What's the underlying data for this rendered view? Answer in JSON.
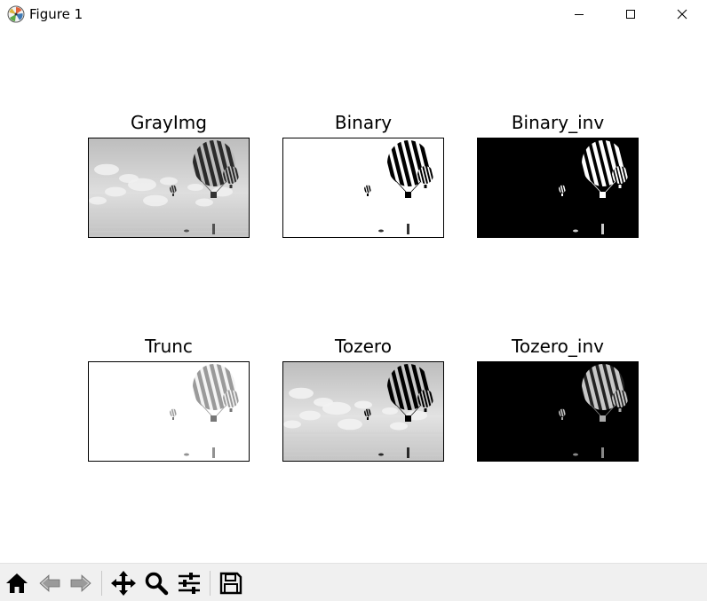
{
  "window": {
    "title": "Figure 1",
    "app_icon": "matplotlib-icon",
    "controls": [
      "minimize-icon",
      "maximize-icon",
      "close-icon"
    ]
  },
  "figure": {
    "subplots": [
      {
        "title": "GrayImg",
        "variant": "gray"
      },
      {
        "title": "Binary",
        "variant": "binary"
      },
      {
        "title": "Binary_inv",
        "variant": "binary_inv"
      },
      {
        "title": "Trunc",
        "variant": "trunc"
      },
      {
        "title": "Tozero",
        "variant": "tozero"
      },
      {
        "title": "Tozero_inv",
        "variant": "tozero_inv"
      }
    ]
  },
  "toolbar": {
    "buttons": [
      {
        "name": "home-button",
        "icon": "home-icon"
      },
      {
        "name": "back-button",
        "icon": "back-arrow-icon"
      },
      {
        "name": "forward-button",
        "icon": "forward-arrow-icon"
      },
      {
        "name": "pan-button",
        "icon": "move-icon"
      },
      {
        "name": "zoom-button",
        "icon": "magnifier-icon"
      },
      {
        "name": "configure-subplots-button",
        "icon": "sliders-icon"
      },
      {
        "name": "save-button",
        "icon": "floppy-disk-icon"
      }
    ]
  },
  "colors": {
    "toolbar_bg": "#f0f0f0",
    "canvas_bg": "#ffffff",
    "frame": "#000000"
  }
}
